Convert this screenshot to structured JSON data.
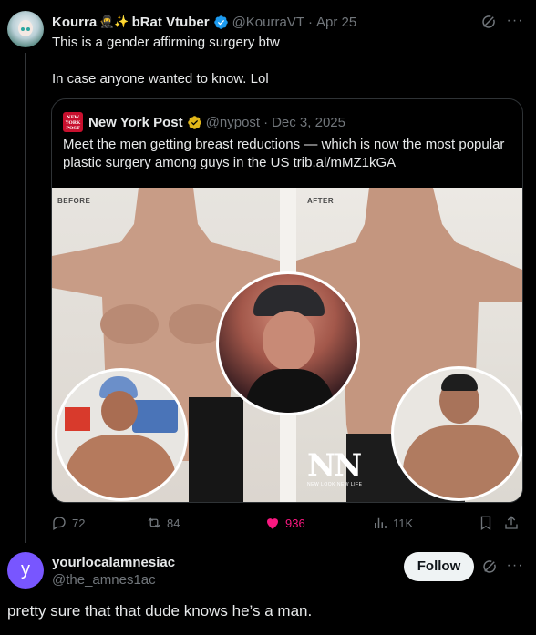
{
  "tweet": {
    "author_name": "Kourra",
    "author_emoji": "🥷✨",
    "author_name_suffix": "bRat Vtuber",
    "handle": "@KourraVT",
    "separator": "·",
    "time": "Apr 25",
    "text_lines": [
      "This is a gender affirming surgery btw",
      "",
      "In case anyone wanted to know. Lol"
    ],
    "more_label": "···"
  },
  "quote": {
    "avatar_text": "NEW YORK POST",
    "name": "New York Post",
    "handle": "@nypost",
    "separator": "·",
    "time": "Dec 3, 2025",
    "text": "Meet the men getting breast reductions — which is now the most popular plastic surgery among guys in the US trib.al/mMZ1kGA",
    "media": {
      "before_label": "BEFORE",
      "after_label": "AFTER",
      "watermark": "NN",
      "watermark_sub": "NEW LOOK NEW LIFE"
    }
  },
  "actions": {
    "replies": "72",
    "reposts": "84",
    "likes": "936",
    "views": "11K"
  },
  "reply": {
    "avatar_letter": "y",
    "name": "yourlocalamnesiac",
    "handle": "@the_amnes1ac",
    "follow_label": "Follow",
    "more_label": "···",
    "text": "pretty sure that that dude knows he’s a man."
  },
  "colors": {
    "background": "#000000",
    "text": "#e7e9ea",
    "muted": "#71767b",
    "verified_gold": "#e2b719",
    "verified_blue": "#1d9bf0",
    "like_pink": "#f91880",
    "reply_avatar": "#7856ff",
    "nypost_red": "#c8102e"
  }
}
